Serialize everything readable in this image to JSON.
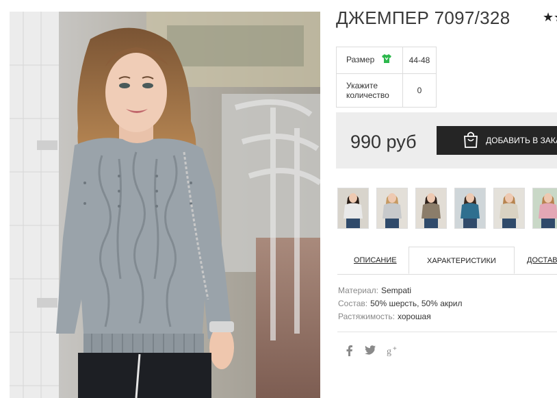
{
  "product": {
    "title": "ДЖЕМПЕР 7097/328",
    "rating_stars": "★★"
  },
  "params": {
    "size_label": "Размер",
    "size_value": "44-48",
    "qty_label": "Укажите количество",
    "qty_value": "0"
  },
  "price": {
    "value": "990 руб",
    "cart_button": "ДОБАВИТЬ В ЗАКАЗ"
  },
  "thumbnails": [
    {
      "name": "thumb-1",
      "sweater": "#e9e9e9",
      "hair": "#2a1d16",
      "bg": "#d8d4cc"
    },
    {
      "name": "thumb-2",
      "sweater": "#c7c9cb",
      "hair": "#c69a63",
      "bg": "#e3dfd8"
    },
    {
      "name": "thumb-3",
      "sweater": "#8b7d6a",
      "hair": "#2d201a",
      "bg": "#e2ddd5"
    },
    {
      "name": "thumb-4",
      "sweater": "#2f6f8f",
      "hair": "#3a2a20",
      "bg": "#cfd6d9"
    },
    {
      "name": "thumb-5",
      "sweater": "#d9d2c2",
      "hair": "#b7844f",
      "bg": "#e4e1da"
    },
    {
      "name": "thumb-6",
      "sweater": "#e3a7b5",
      "hair": "#b98250",
      "bg": "#c9d8c7"
    }
  ],
  "tabs": {
    "description": "ОПИСАНИЕ",
    "characteristics": "ХАРАКТЕРИСТИКИ",
    "delivery": "ДОСТАВКА"
  },
  "specs": {
    "material_key": "Материал:",
    "material_val": "Sempati",
    "composition_key": "Состав:",
    "composition_val": "50% шерсть, 50% акрил",
    "stretch_key": "Растяжимость:",
    "stretch_val": "хорошая"
  },
  "social": {
    "facebook": "f",
    "twitter": "🐦",
    "googleplus": "g+"
  },
  "colors": {
    "accent_green": "#2db84d",
    "button_dark": "#252525",
    "price_bg": "#ededed"
  }
}
